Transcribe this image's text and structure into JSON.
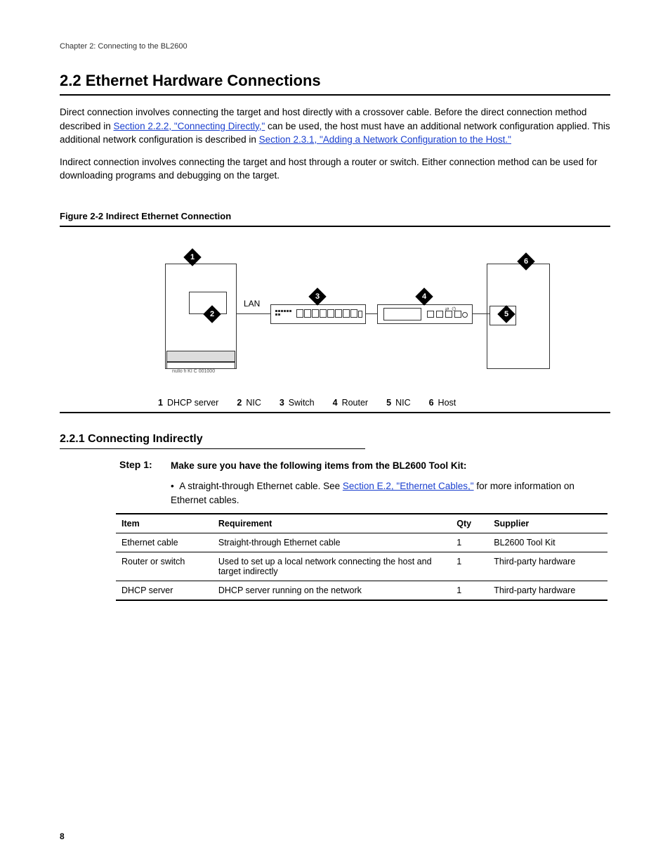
{
  "header": {
    "chapter": "Chapter 2: Connecting to the BL2600"
  },
  "section": {
    "title": "2.2 Ethernet Hardware Connections",
    "para1_a": "Direct connection involves connecting the target and host directly with a crossover cable. Before the direct connection method described in ",
    "para1_link": "Section 2.2.2, \"Connecting Directly,\"",
    "para1_b": " can be used, the host must have an additional network configuration applied. This additional network configuration is described in ",
    "para1_link2": "Section 2.3.1, \"Adding a Network Configuration to the Host.\"",
    "para2": "Indirect connection involves connecting the target and host through a router or switch. Either connection method can be used for downloading programs and debugging on the target."
  },
  "figure": {
    "caption": "Figure 2-2 Indirect Ethernet Connection",
    "lan_label": "LAN",
    "server_foot": "nullo fi KI C 001000",
    "callouts": {
      "c1": "1",
      "c2": "2",
      "c3": "3",
      "c4": "4",
      "c5": "5",
      "c6": "6"
    },
    "legend": [
      {
        "n": "1",
        "t": "DHCP server"
      },
      {
        "n": "2",
        "t": "NIC"
      },
      {
        "n": "3",
        "t": "Switch"
      },
      {
        "n": "4",
        "t": "Router"
      },
      {
        "n": "5",
        "t": "NIC"
      },
      {
        "n": "6",
        "t": "Host"
      }
    ]
  },
  "subsection": {
    "title": "2.2.1 Connecting Indirectly"
  },
  "step": {
    "label": "Step 1:",
    "lead": "Make sure you have the following items from the BL2600 Tool Kit:",
    "bullet_a": "A straight-through Ethernet cable. See ",
    "bullet_link": "Section E.2, \"Ethernet Cables,\"",
    "bullet_b": " for more information on Ethernet cables."
  },
  "table": {
    "headers": {
      "item": "Item",
      "req": "Requirement",
      "qty": "Qty",
      "sup": "Supplier"
    },
    "rows": [
      {
        "item": "Ethernet cable",
        "req": "Straight-through Ethernet cable",
        "qty": "1",
        "sup": "BL2600 Tool Kit"
      },
      {
        "item": "Router or switch",
        "req": "Used to set up a local network connecting the host and target indirectly",
        "qty": "1",
        "sup": "Third-party hardware"
      },
      {
        "item": "DHCP server",
        "req": "DHCP server running on the network",
        "qty": "1",
        "sup": "Third-party hardware"
      }
    ]
  },
  "page_number": "8"
}
